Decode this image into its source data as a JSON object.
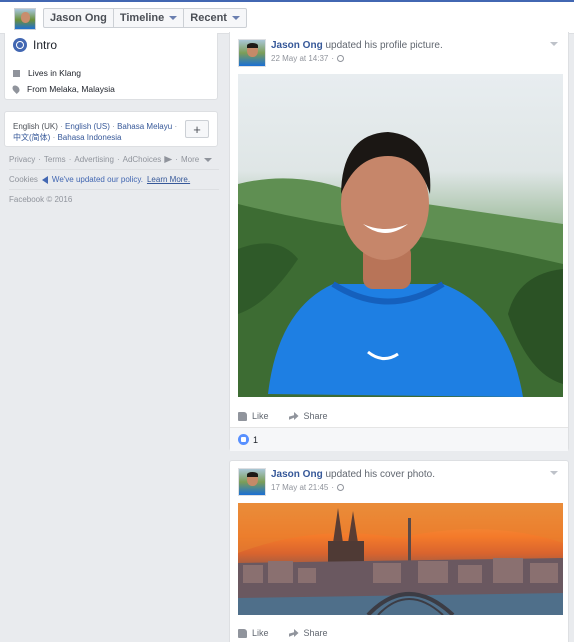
{
  "nav": {
    "tabs": [
      {
        "label": "Jason Ong"
      },
      {
        "label": "Timeline"
      },
      {
        "label": "Recent"
      }
    ]
  },
  "intro": {
    "title": "Intro",
    "lives_in": "Lives in Klang",
    "from": "From Melaka, Malaysia"
  },
  "languages": {
    "current": "English (UK)",
    "others": [
      "English (US)",
      "Bahasa Melayu",
      "中文(简体)",
      "Bahasa Indonesia"
    ],
    "add_label": "+"
  },
  "footer": {
    "links": [
      "Privacy",
      "Terms",
      "Advertising",
      "AdChoices",
      "More"
    ],
    "cookies": "Cookies",
    "policy_text": "We've updated our policy.",
    "learn_more": "Learn More.",
    "copyright": "Facebook © 2016"
  },
  "posts": [
    {
      "author": "Jason Ong",
      "action": "updated his profile picture.",
      "date": "22 May at 14:37",
      "like_label": "Like",
      "share_label": "Share",
      "reaction_count": "1"
    },
    {
      "author": "Jason Ong",
      "action": "updated his cover photo.",
      "date": "17 May at 21:45",
      "like_label": "Like",
      "share_label": "Share"
    }
  ],
  "colors": {
    "brand": "#4267b2",
    "link": "#365899",
    "background": "#e9ebee"
  }
}
